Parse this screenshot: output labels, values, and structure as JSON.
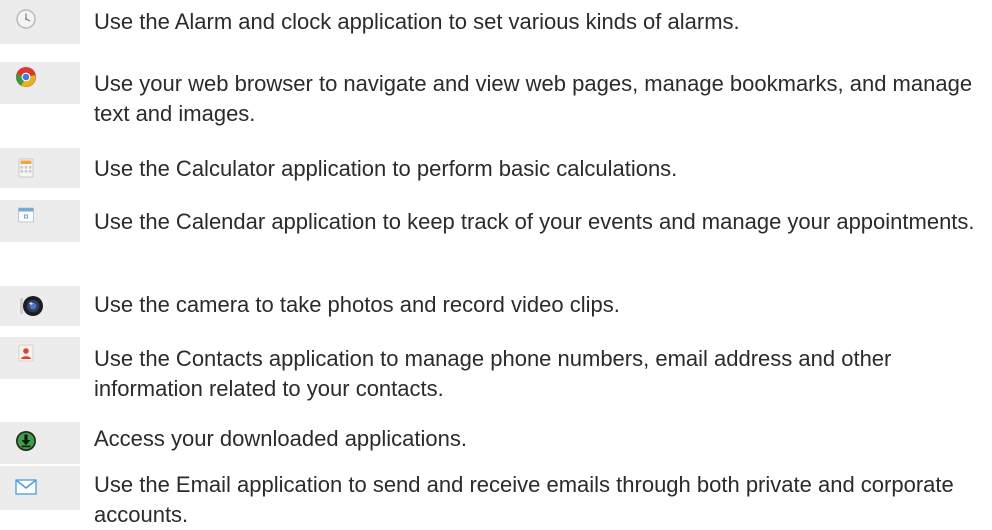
{
  "apps": [
    {
      "icon": "alarm-clock-icon",
      "description": "Use the Alarm and clock application to set various kinds of alarms."
    },
    {
      "icon": "web-browser-icon",
      "description": "Use your web browser to navigate and view web pages, manage bookmarks, and manage text and images."
    },
    {
      "icon": "calculator-icon",
      "description": "Use the Calculator application to perform basic calculations."
    },
    {
      "icon": "calendar-icon",
      "description": "Use the Calendar application to keep track of your events and manage your appointments."
    },
    {
      "icon": "camera-icon",
      "description": "Use the camera to take photos and record video clips."
    },
    {
      "icon": "contacts-icon",
      "description": "Use the Contacts application to manage phone numbers, email address and other information related to your contacts."
    },
    {
      "icon": "download-icon",
      "description": "Access your downloaded applications."
    },
    {
      "icon": "email-icon",
      "description": "Use the Email application to send and receive emails through both private and corporate accounts."
    }
  ],
  "colors": {
    "icon_cell_background": "#ececec",
    "text": "#2b2b2b"
  }
}
